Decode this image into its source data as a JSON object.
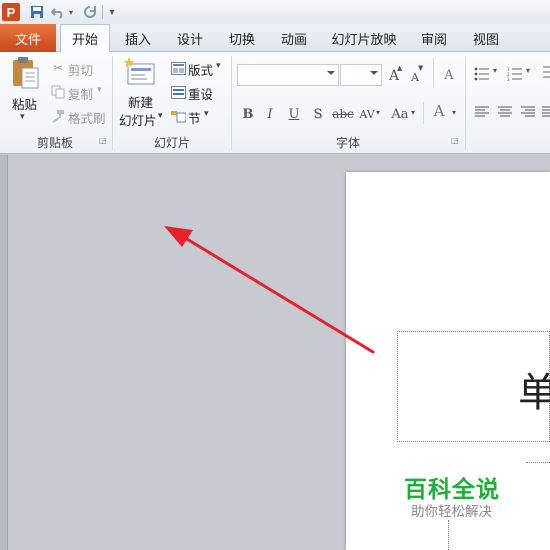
{
  "quick_access": {
    "app_letter": "P",
    "icons": [
      "save-icon",
      "undo-icon",
      "redo-icon",
      "customize-icon"
    ]
  },
  "tabs": [
    "文件",
    "开始",
    "插入",
    "设计",
    "切换",
    "动画",
    "幻灯片放映",
    "审阅",
    "视图"
  ],
  "ribbon": {
    "clipboard": {
      "paste": "粘贴",
      "cut": "剪切",
      "copy": "复制",
      "format_painter": "格式刷",
      "group": "剪贴板"
    },
    "slides": {
      "new_slide_line1": "新建",
      "new_slide_line2": "幻灯片",
      "layout": "版式",
      "reset": "重设",
      "section": "节",
      "group": "幻灯片"
    },
    "font": {
      "group": "字体",
      "grow": "A",
      "shrink": "A",
      "clear": "A",
      "bold": "B",
      "italic": "I",
      "underline": "U",
      "shadow": "S",
      "strike": "abc",
      "spacing": "AV",
      "case": "Aa",
      "color": "A"
    }
  },
  "slide": {
    "title_text": "单"
  },
  "watermark": {
    "title": "百科全说",
    "subtitle": "助你轻松解决"
  },
  "colors": {
    "file_tab": "#d04a1c",
    "arrow": "#e8202a",
    "watermark_green": "#1fae3a"
  }
}
